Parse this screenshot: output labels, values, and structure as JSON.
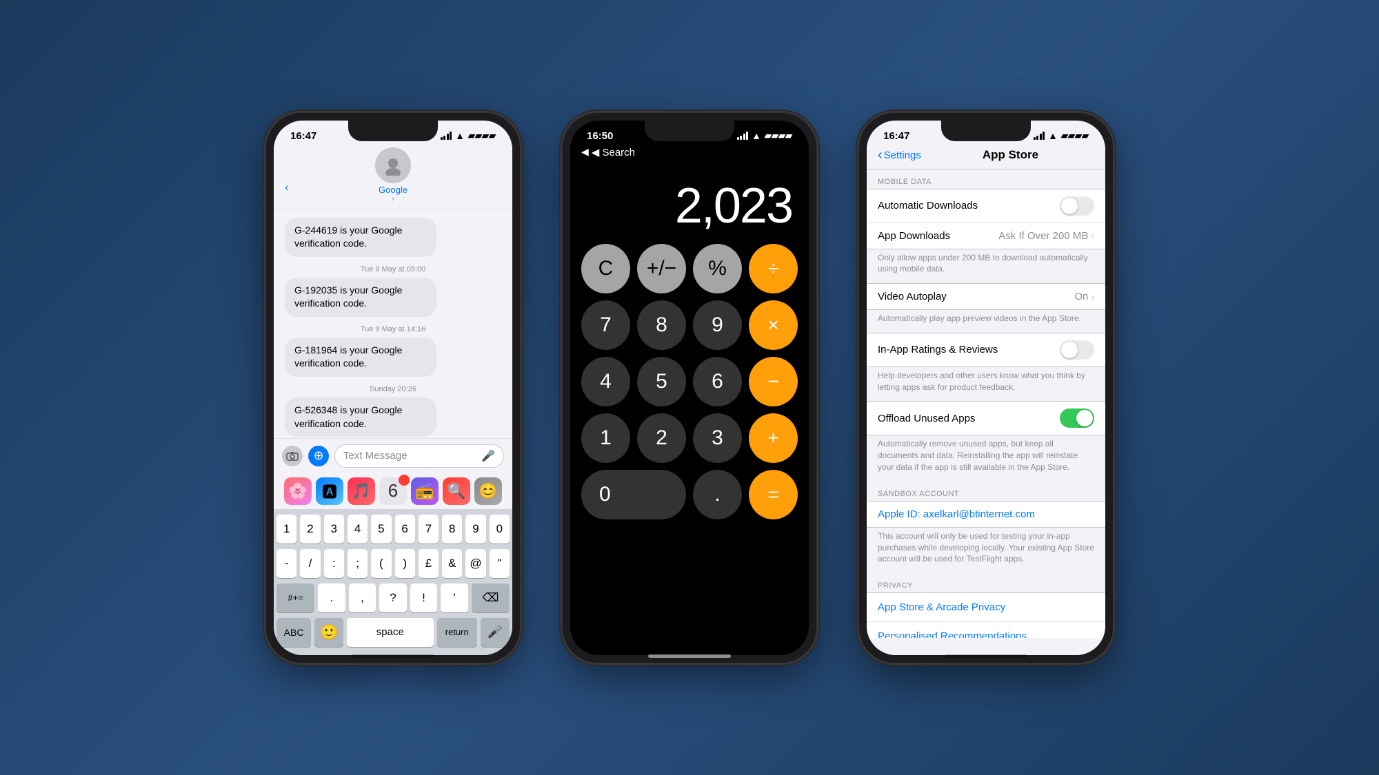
{
  "phone1": {
    "status": {
      "time": "16:47",
      "signal": [
        2,
        3,
        4,
        5
      ],
      "wifi": "wifi",
      "battery": "battery"
    },
    "contact": {
      "name": "Google",
      "avatar": "👤"
    },
    "messages": [
      {
        "text": "G-244619 is your Google verification code.",
        "timestamp": null
      },
      {
        "text": null,
        "timestamp": "Tue 9 May at 09:00"
      },
      {
        "text": "G-192035 is your Google verification code.",
        "timestamp": null
      },
      {
        "text": null,
        "timestamp": "Tue 9 May at 14:16"
      },
      {
        "text": "G-181964 is your Google verification code.",
        "timestamp": null
      },
      {
        "text": null,
        "timestamp": "Sunday 20:26"
      },
      {
        "text": "G-526348 is your Google verification code.",
        "timestamp": null
      }
    ],
    "input_placeholder": "Text Message",
    "keyboard": {
      "numbers_row": [
        "1",
        "2",
        "3",
        "4",
        "5",
        "6",
        "7",
        "8",
        "9",
        "0"
      ],
      "symbols_row": [
        "-",
        "/",
        ":",
        ";",
        "(",
        ")",
        "£",
        "&",
        "@",
        "\""
      ],
      "special_row": [
        "#+=",
        ".",
        ",",
        "?",
        "!",
        "'",
        "⌫"
      ],
      "bottom_row": [
        "ABC",
        "space",
        "return"
      ]
    },
    "dock_icons": [
      "📷",
      "🅰",
      "🎵",
      "6",
      "📻",
      "🔍",
      "😊"
    ]
  },
  "phone2": {
    "status": {
      "time": "16:50",
      "back_label": "◀ Search",
      "wifi": "wifi",
      "battery": "battery"
    },
    "display": "2,023",
    "buttons": [
      [
        "C",
        "+/-",
        "%",
        "÷"
      ],
      [
        "7",
        "8",
        "9",
        "×"
      ],
      [
        "4",
        "5",
        "6",
        "−"
      ],
      [
        "1",
        "2",
        "3",
        "+"
      ],
      [
        "0",
        ".",
        "="
      ]
    ]
  },
  "phone3": {
    "status": {
      "time": "16:47",
      "wifi": "wifi",
      "battery": "battery"
    },
    "nav": {
      "back": "Settings",
      "title": "App Store"
    },
    "sections": {
      "mobile_data_label": "MOBILE DATA",
      "automatic_downloads_label": "Automatic Downloads",
      "automatic_downloads_toggle": "off",
      "app_downloads_label": "App Downloads",
      "app_downloads_value": "Ask If Over 200 MB",
      "app_downloads_note": "Only allow apps under 200 MB to download automatically using mobile data.",
      "video_autoplay_label": "Video Autoplay",
      "video_autoplay_value": "On",
      "video_autoplay_note": "Automatically play app preview videos in the App Store.",
      "in_app_ratings_label": "In-App Ratings & Reviews",
      "in_app_ratings_toggle": "off",
      "in_app_ratings_note": "Help developers and other users know what you think by letting apps ask for product feedback.",
      "offload_label": "Offload Unused Apps",
      "offload_toggle": "on",
      "offload_note": "Automatically remove unused apps, but keep all documents and data. Reinstalling the app will reinstate your data if the app is still available in the App Store.",
      "sandbox_label": "SANDBOX ACCOUNT",
      "apple_id_label": "Apple ID: axelkarl@btinternet.com",
      "sandbox_note": "This account will only be used for testing your in-app purchases while developing locally. Your existing App Store account will be used for TestFlight apps.",
      "privacy_label": "PRIVACY",
      "arcade_privacy_label": "App Store & Arcade Privacy",
      "personalised_label": "Personalised Recommendations"
    }
  }
}
